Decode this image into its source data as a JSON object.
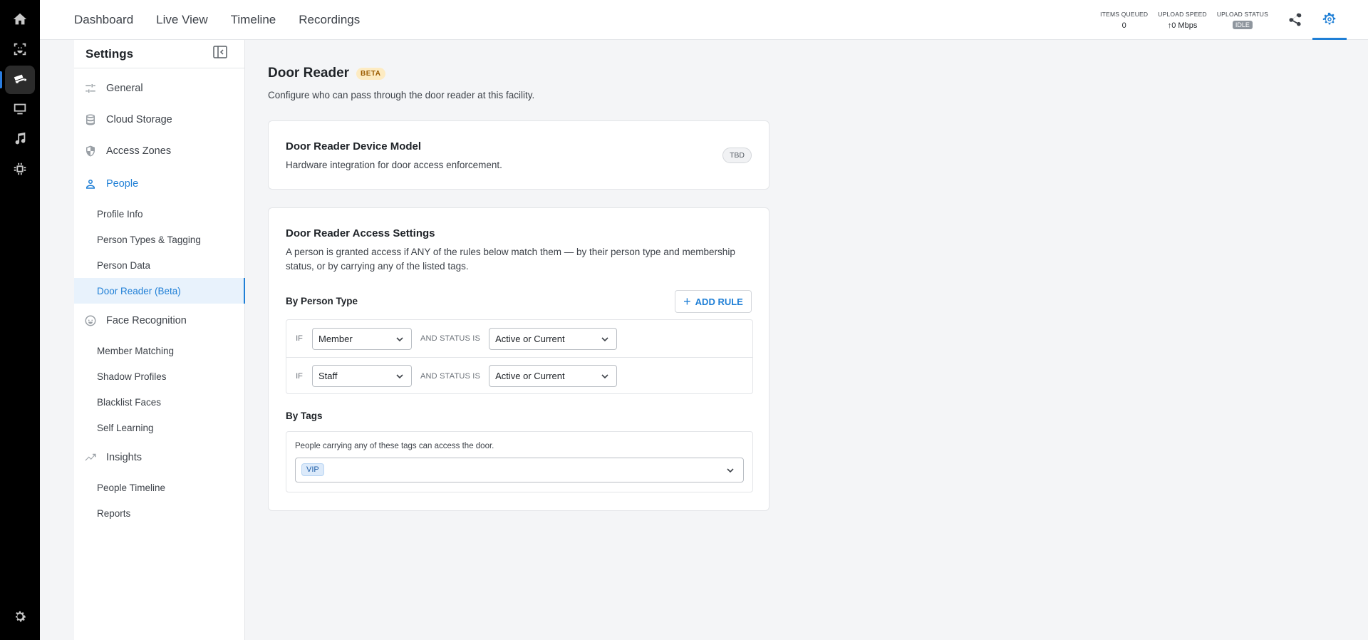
{
  "topnav": [
    "Dashboard",
    "Live View",
    "Timeline",
    "Recordings"
  ],
  "stats": {
    "items_queued_label": "ITEMS QUEUED",
    "items_queued_value": "0",
    "upload_speed_label": "UPLOAD SPEED",
    "upload_speed_value": "↑0 Mbps",
    "upload_status_label": "UPLOAD STATUS",
    "upload_status_value": "IDLE"
  },
  "sidebar": {
    "title": "Settings",
    "groups": {
      "general": "General",
      "cloud_storage": "Cloud Storage",
      "access_zones": "Access Zones",
      "people": "People",
      "face_recognition": "Face Recognition",
      "insights": "Insights"
    },
    "people_items": [
      "Profile Info",
      "Person Types & Tagging",
      "Person Data",
      "Door Reader (Beta)"
    ],
    "face_items": [
      "Member Matching",
      "Shadow Profiles",
      "Blacklist Faces",
      "Self Learning"
    ],
    "insights_items": [
      "People Timeline",
      "Reports"
    ]
  },
  "page": {
    "title": "Door Reader",
    "badge": "BETA",
    "description": "Configure who can pass through the door reader at this facility."
  },
  "device_card": {
    "title": "Door Reader Device Model",
    "description": "Hardware integration for door access enforcement.",
    "badge": "TBD"
  },
  "access_card": {
    "title": "Door Reader Access Settings",
    "description": "A person is granted access if ANY of the rules below match them — by their person type and membership status, or by carrying any of the listed tags.",
    "by_person_type_label": "By Person Type",
    "add_rule_label": "ADD RULE",
    "if_label": "IF",
    "and_status_label": "AND STATUS IS",
    "rules": [
      {
        "type": "Member",
        "status": "Active or Current"
      },
      {
        "type": "Staff",
        "status": "Active or Current"
      }
    ],
    "by_tags_label": "By Tags",
    "tags_hint": "People carrying any of these tags can access the door.",
    "tags": [
      "VIP"
    ]
  },
  "colors": {
    "accent": "#1f7fd6",
    "rail_bg": "#000000",
    "page_bg": "#f4f5f7"
  }
}
